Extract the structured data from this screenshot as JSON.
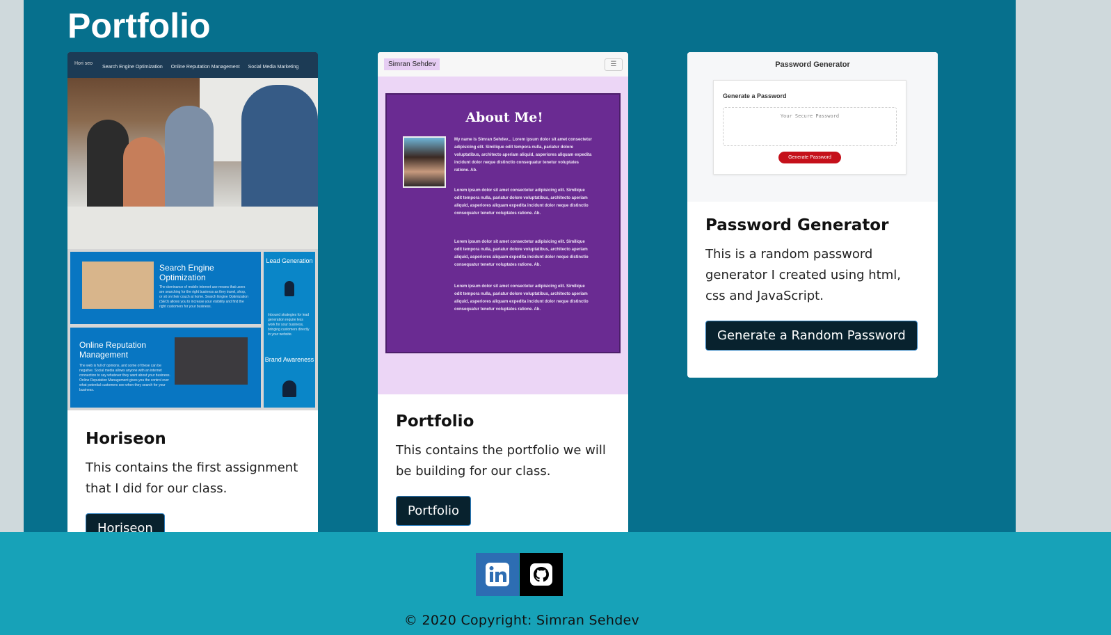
{
  "page": {
    "title": "Portfolio"
  },
  "projects": [
    {
      "title": "Horiseon",
      "description": "This contains the first assignment that I did for our class.",
      "button_label": "Horiseon",
      "screenshot": {
        "logo": "Hori seo",
        "nav_links": [
          "Search Engine Optimization",
          "Online Reputation Management",
          "Social Media Marketing"
        ],
        "block_1_title": "Search Engine Optimization",
        "block_1_text": "The dominance of mobile internet use means that users are searching for the right business as they travel, shop, or sit on their couch at home. Search Engine Optimization (SEO) allows you to increase your visibility and find the right customers for your business.",
        "block_2_title": "Online Reputation Management",
        "block_2_text": "The web is full of opinions, and some of these can be negative. Social media allows anyone with an internet connection to say whatever they want about your business. Online Reputation Management gives you the control over what potential customers see when they search for your business.",
        "side_1_title": "Lead Generation",
        "side_1_text": "Inbound strategies for lead generation require less work for your business, bringing customers directly to your website.",
        "side_2_title": "Brand Awareness"
      }
    },
    {
      "title": "Portfolio",
      "description": "This contains the portfolio we will be building for our class.",
      "button_label": "Portfolio",
      "screenshot": {
        "brand": "Simran Sehdev",
        "heading": "About Me!",
        "paragraphs": [
          "My name is Simran Sehdev... Lorem ipsum dolor sit amet consectetur adipisicing elit. Similique odit tempora nulla, pariatur dolore voluptatibus, architecto aperiam aliquid, asperiores aliquam expedita incidunt dolor neque distinctio consequatur tenetur voluptates ratione. Ab.",
          "Lorem ipsum dolor sit amet consectetur adipisicing elit. Similique odit tempora nulla, pariatur dolore voluptatibus, architecto aperiam aliquid, asperiores aliquam expedita incidunt dolor neque distinctio consequatur tenetur voluptates ratione. Ab.",
          "Lorem ipsum dolor sit amet consectetur adipisicing elit. Similique odit tempora nulla, pariatur dolore voluptatibus, architecto aperiam aliquid, asperiores aliquam expedita incidunt dolor neque distinctio consequatur tenetur voluptates ratione. Ab.",
          "Lorem ipsum dolor sit amet consectetur adipisicing elit. Similique odit tempora nulla, pariatur dolore voluptatibus, architecto aperiam aliquid, asperiores aliquam expedita incidunt dolor neque distinctio consequatur tenetur voluptates ratione. Ab."
        ]
      }
    },
    {
      "title": "Password Generator",
      "description": "This is a random password generator I created using html, css and JavaScript.",
      "button_label": "Generate a Random Password",
      "screenshot": {
        "title": "Password Generator",
        "card_heading": "Generate a Password",
        "placeholder": "Your Secure Password",
        "button": "Generate Password"
      }
    }
  ],
  "footer": {
    "social": [
      {
        "name": "LinkedIn",
        "icon": "linkedin-icon",
        "color": "#2d6db3"
      },
      {
        "name": "GitHub",
        "icon": "github-icon",
        "color": "#000000"
      }
    ],
    "copyright": "© 2020 Copyright: Simran Sehdev"
  },
  "colors": {
    "main_bg": "#06708d",
    "footer_bg": "#17a2b8",
    "page_bg": "#cfd9dc",
    "button_bg": "#08222e"
  }
}
